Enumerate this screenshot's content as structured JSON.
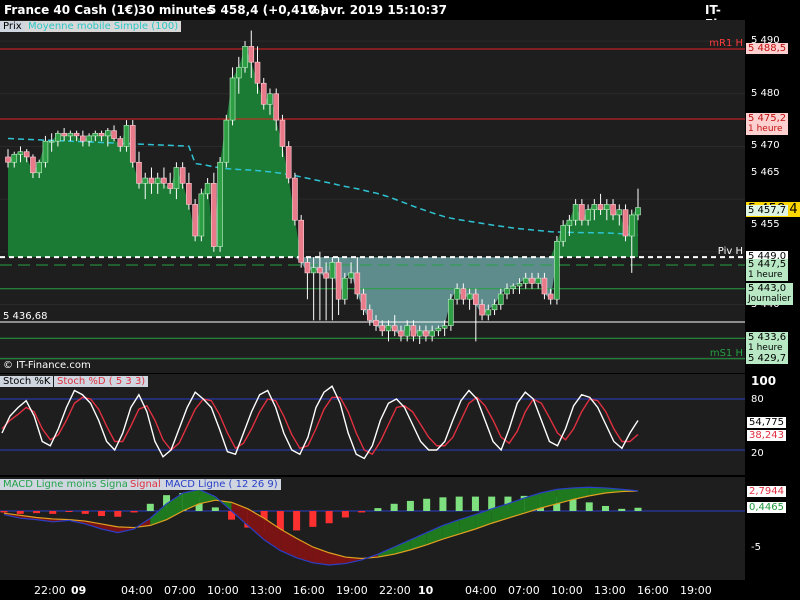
{
  "header": {
    "instrument": "France 40 Cash (1€)",
    "timeframe": "30 minutes",
    "quote": "5 458,4 (+0,41%)",
    "datetime": "10 avr. 2019 15:10:37",
    "brand": "IT-Finance.com"
  },
  "price_panel": {
    "tab_label": "Prix",
    "ma_legend": "Moyenne mobile Simple (100)",
    "watermark": "© IT-Finance.com",
    "left_level_label": "5 436,68",
    "y_ticks": [
      "5 490",
      "5 480",
      "5 470",
      "5 465",
      "5 455",
      "5 440",
      "5 430"
    ],
    "levels": [
      {
        "label": "mR1 H",
        "value": "5 488,5",
        "color": "#ff3b3b"
      },
      {
        "label": "",
        "value": "5 475,2",
        "sub": "1 heure",
        "color": "#ff3b3b"
      },
      {
        "label": "",
        "value": "5 458,4",
        "color": "#ffd700"
      },
      {
        "label": "",
        "value": "5 457,7",
        "color": "#1f9b3c"
      },
      {
        "label": "Piv H",
        "value": "5 449,0",
        "color": "#ffffff"
      },
      {
        "label": "",
        "value": "5 447,5",
        "sub": "1 heure",
        "color": "#27a042"
      },
      {
        "label": "",
        "value": "5 443,0",
        "sub": "Journalier",
        "color": "#27a042"
      },
      {
        "label": "",
        "value": "5 433,6",
        "sub": "1 heure",
        "color": "#27a042"
      },
      {
        "label": "mS1 H",
        "value": "5 429,7",
        "color": "#27a042"
      }
    ]
  },
  "stoch_panel": {
    "label_k": "Stoch %K",
    "label_d": "Stoch %D ( 5 3 3)",
    "y_ticks": [
      "100",
      "80",
      "20"
    ],
    "value_k": "54,775",
    "value_d": "38,243"
  },
  "macd_panel": {
    "label_hist": "MACD Ligne moins Signal",
    "label_signal": "Signal",
    "label_macd": "MACD Ligne ( 12 26 9)",
    "y_ticks": [
      "-5"
    ],
    "value_signal": "2,7944",
    "value_hist": "0,4465"
  },
  "x_axis": {
    "labels": [
      "22:00",
      "09",
      "04:00",
      "07:00",
      "10:00",
      "13:00",
      "16:00",
      "19:00",
      "22:00",
      "10",
      "04:00",
      "07:00",
      "10:00",
      "13:00",
      "16:00",
      "19:00"
    ]
  },
  "chart_data": {
    "type": "candlestick",
    "title": "France 40 Cash (1€) 30 minutes",
    "ylim": [
      5427,
      5494
    ],
    "moving_average": "Moyenne mobile Simple (100)",
    "candles": [
      [
        5468,
        5469.5,
        5466,
        5467
      ],
      [
        5467,
        5469,
        5466,
        5468.5
      ],
      [
        5468.5,
        5470,
        5467,
        5469
      ],
      [
        5469,
        5469.5,
        5467,
        5468
      ],
      [
        5468,
        5468.5,
        5464,
        5465
      ],
      [
        5465,
        5467.5,
        5464,
        5467
      ],
      [
        5467,
        5472,
        5466,
        5471
      ],
      [
        5471,
        5472.5,
        5469,
        5471
      ],
      [
        5471,
        5473,
        5470,
        5472.5
      ],
      [
        5472.5,
        5473.5,
        5471,
        5472
      ],
      [
        5472,
        5473,
        5471,
        5472.5
      ],
      [
        5472.5,
        5473,
        5471,
        5472
      ],
      [
        5472,
        5473,
        5470,
        5471
      ],
      [
        5471,
        5472.5,
        5470,
        5472
      ],
      [
        5472,
        5473,
        5471,
        5472.5
      ],
      [
        5472.5,
        5473,
        5471,
        5472
      ],
      [
        5472,
        5473.5,
        5470,
        5473
      ],
      [
        5473,
        5474,
        5471,
        5471.5
      ],
      [
        5471.5,
        5472,
        5469,
        5470
      ],
      [
        5470,
        5475,
        5469,
        5474
      ],
      [
        5474,
        5475,
        5466,
        5467
      ],
      [
        5467,
        5469,
        5462,
        5463
      ],
      [
        5463,
        5465,
        5460,
        5464
      ],
      [
        5464,
        5466,
        5461,
        5463
      ],
      [
        5463,
        5465,
        5461,
        5464
      ],
      [
        5464,
        5466,
        5462,
        5463
      ],
      [
        5463,
        5465,
        5461,
        5462
      ],
      [
        5462,
        5467,
        5460,
        5466
      ],
      [
        5466,
        5467,
        5462,
        5463
      ],
      [
        5463,
        5465,
        5458,
        5459
      ],
      [
        5459,
        5460,
        5452,
        5453
      ],
      [
        5453,
        5462,
        5452,
        5461
      ],
      [
        5461,
        5464,
        5460,
        5463
      ],
      [
        5463,
        5465,
        5450,
        5451
      ],
      [
        5451,
        5468,
        5450,
        5467
      ],
      [
        5467,
        5476,
        5466,
        5475
      ],
      [
        5475,
        5485,
        5474,
        5483
      ],
      [
        5483,
        5487,
        5480,
        5485
      ],
      [
        5485,
        5490,
        5484,
        5489
      ],
      [
        5489,
        5492,
        5483,
        5486
      ],
      [
        5486,
        5489,
        5480,
        5482
      ],
      [
        5482,
        5483,
        5477,
        5478
      ],
      [
        5478,
        5481,
        5476,
        5480
      ],
      [
        5480,
        5481,
        5473,
        5475
      ],
      [
        5475,
        5476,
        5468,
        5470
      ],
      [
        5470,
        5471,
        5463,
        5464
      ],
      [
        5464,
        5465,
        5455,
        5456
      ],
      [
        5456,
        5457,
        5447,
        5448
      ],
      [
        5448,
        5449,
        5441,
        5446
      ],
      [
        5446,
        5449,
        5437,
        5447
      ],
      [
        5447,
        5450,
        5437,
        5446
      ],
      [
        5446,
        5448,
        5437,
        5445
      ],
      [
        5445,
        5449,
        5437,
        5448
      ],
      [
        5448,
        5449,
        5438,
        5441
      ],
      [
        5441,
        5446,
        5440,
        5445
      ],
      [
        5445,
        5448,
        5444,
        5446
      ],
      [
        5446,
        5449,
        5441,
        5442
      ],
      [
        5442,
        5443,
        5438,
        5439
      ],
      [
        5439,
        5440,
        5436,
        5437
      ],
      [
        5437,
        5438,
        5435,
        5436
      ],
      [
        5436,
        5437,
        5434,
        5435
      ],
      [
        5435,
        5437,
        5433,
        5436
      ],
      [
        5436,
        5438,
        5434,
        5435
      ],
      [
        5435,
        5436,
        5433,
        5434
      ],
      [
        5434,
        5437,
        5433,
        5436
      ],
      [
        5436,
        5437,
        5433,
        5434
      ],
      [
        5434,
        5436,
        5432.5,
        5435
      ],
      [
        5435,
        5436,
        5433,
        5434
      ],
      [
        5434,
        5436,
        5433,
        5435
      ],
      [
        5435,
        5436,
        5434,
        5435.5
      ],
      [
        5435.5,
        5437,
        5434,
        5436
      ],
      [
        5436,
        5442,
        5435,
        5441
      ],
      [
        5441,
        5444,
        5440,
        5443
      ],
      [
        5443,
        5444,
        5440,
        5441
      ],
      [
        5441,
        5443,
        5439,
        5442
      ],
      [
        5442,
        5443,
        5433,
        5440
      ],
      [
        5440,
        5441,
        5437,
        5438
      ],
      [
        5438,
        5440,
        5437,
        5439
      ],
      [
        5439,
        5441,
        5438,
        5440
      ],
      [
        5440,
        5443,
        5439,
        5442
      ],
      [
        5442,
        5444,
        5441,
        5443
      ],
      [
        5443,
        5444,
        5442,
        5443.5
      ],
      [
        5443.5,
        5445,
        5442,
        5444
      ],
      [
        5444,
        5446,
        5443,
        5445
      ],
      [
        5445,
        5446,
        5443,
        5444
      ],
      [
        5444,
        5446,
        5443,
        5445
      ],
      [
        5445,
        5446,
        5441,
        5442
      ],
      [
        5442,
        5443,
        5440,
        5441
      ],
      [
        5441,
        5453,
        5440,
        5452
      ],
      [
        5452,
        5456,
        5451,
        5455
      ],
      [
        5455,
        5457,
        5453,
        5456
      ],
      [
        5456,
        5460,
        5455,
        5459
      ],
      [
        5459,
        5460,
        5455,
        5456
      ],
      [
        5456,
        5459,
        5455,
        5458
      ],
      [
        5458,
        5460,
        5456,
        5459
      ],
      [
        5459,
        5461,
        5457,
        5458
      ],
      [
        5458,
        5460,
        5456,
        5459
      ],
      [
        5459,
        5460,
        5456,
        5457
      ],
      [
        5457,
        5459,
        5455,
        5458
      ],
      [
        5458,
        5459,
        5452,
        5453
      ],
      [
        5453,
        5458,
        5446,
        5457
      ],
      [
        5457,
        5462,
        5456,
        5458.4
      ]
    ],
    "stochastic": {
      "k": [
        40,
        60,
        70,
        78,
        60,
        30,
        25,
        45,
        70,
        90,
        85,
        75,
        55,
        30,
        20,
        40,
        70,
        85,
        65,
        30,
        12,
        20,
        45,
        70,
        88,
        80,
        70,
        45,
        18,
        15,
        40,
        65,
        85,
        90,
        70,
        40,
        20,
        15,
        35,
        70,
        88,
        95,
        75,
        40,
        15,
        10,
        25,
        55,
        75,
        80,
        70,
        50,
        30,
        20,
        20,
        30,
        55,
        78,
        90,
        80,
        55,
        30,
        20,
        45,
        75,
        88,
        80,
        55,
        30,
        25,
        45,
        72,
        85,
        82,
        70,
        50,
        30,
        22,
        40,
        54.775
      ],
      "d": [
        45,
        55,
        62,
        70,
        65,
        45,
        32,
        38,
        55,
        75,
        82,
        80,
        68,
        48,
        30,
        30,
        48,
        68,
        72,
        55,
        32,
        20,
        28,
        48,
        68,
        80,
        78,
        62,
        40,
        22,
        28,
        45,
        65,
        80,
        78,
        60,
        38,
        22,
        25,
        45,
        68,
        82,
        82,
        65,
        40,
        20,
        15,
        30,
        50,
        70,
        72,
        65,
        50,
        35,
        25,
        25,
        35,
        55,
        75,
        82,
        72,
        55,
        35,
        28,
        42,
        65,
        80,
        75,
        58,
        40,
        32,
        45,
        65,
        80,
        78,
        65,
        45,
        30,
        30,
        38.243
      ]
    },
    "macd": {
      "macd": [
        -0.5,
        -1,
        -1.2,
        -1.5,
        -1.3,
        -1.8,
        -2.5,
        -3,
        -2.5,
        -1,
        1,
        2.5,
        3,
        2,
        0,
        -2,
        -4,
        -5.5,
        -6.5,
        -7.2,
        -7.5,
        -7.3,
        -6.8,
        -6,
        -5,
        -4,
        -3,
        -2,
        -1.2,
        -0.5,
        0.3,
        1,
        1.8,
        2.5,
        3,
        3.2,
        3.3,
        3.2,
        3,
        2.8
      ],
      "signal": [
        -0.3,
        -0.6,
        -0.9,
        -1.1,
        -1.2,
        -1.4,
        -1.8,
        -2.2,
        -2.3,
        -2,
        -1.2,
        0,
        1,
        1.5,
        1.2,
        0.3,
        -1,
        -2.5,
        -3.8,
        -5,
        -5.8,
        -6.4,
        -6.6,
        -6.4,
        -6,
        -5.4,
        -4.7,
        -3.9,
        -3.2,
        -2.5,
        -1.7,
        -1,
        -0.3,
        0.4,
        1,
        1.6,
        2.1,
        2.5,
        2.7,
        2.79
      ],
      "histogram": [
        -0.2,
        -0.4,
        -0.3,
        -0.4,
        -0.1,
        -0.4,
        -0.7,
        -0.8,
        -0.2,
        1,
        2.2,
        2.5,
        2,
        0.5,
        -1.2,
        -2.3,
        -3,
        -3,
        -2.7,
        -2.2,
        -1.7,
        -0.9,
        -0.2,
        0.4,
        1,
        1.4,
        1.7,
        1.9,
        2,
        2,
        2,
        2,
        2.1,
        2.1,
        2,
        1.6,
        1.2,
        0.7,
        0.3,
        0.45
      ]
    }
  }
}
